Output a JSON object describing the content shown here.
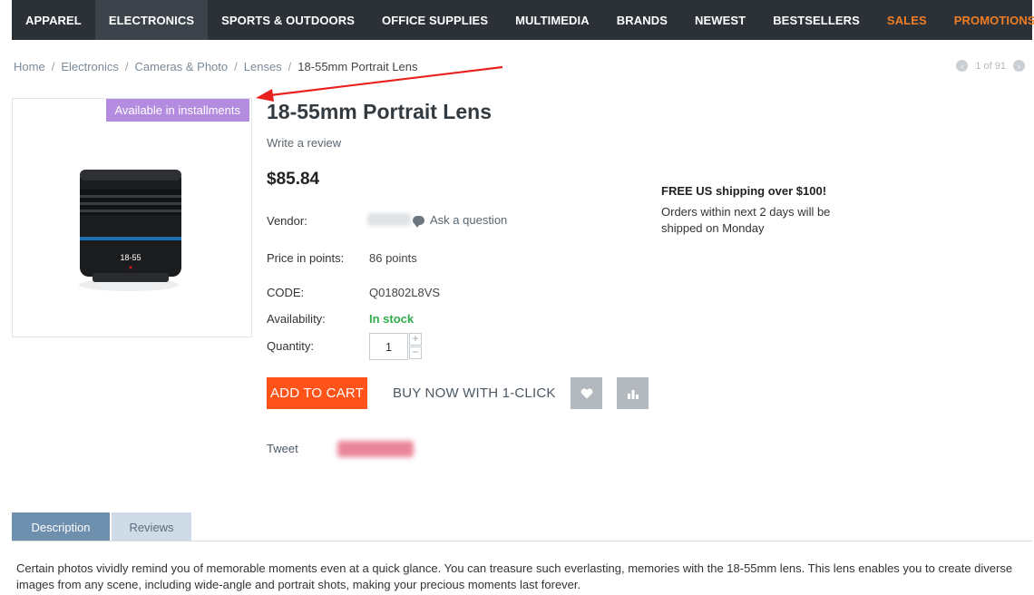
{
  "nav": {
    "items": [
      {
        "label": "APPAREL"
      },
      {
        "label": "ELECTRONICS"
      },
      {
        "label": "SPORTS & OUTDOORS"
      },
      {
        "label": "OFFICE SUPPLIES"
      },
      {
        "label": "MULTIMEDIA"
      },
      {
        "label": "BRANDS"
      },
      {
        "label": "NEWEST"
      },
      {
        "label": "BESTSELLERS"
      },
      {
        "label": "SALES"
      },
      {
        "label": "PROMOTIONS"
      }
    ],
    "active_label": "ELECTRONICS",
    "accent_color": "#f07d24",
    "background_color": "#2b3137"
  },
  "breadcrumb": {
    "items": [
      "Home",
      "Electronics",
      "Cameras & Photo",
      "Lenses",
      "18-55mm Portrait Lens"
    ],
    "separator": "/"
  },
  "pager": {
    "text": "1 of 91",
    "prev_icon": "chevron-left-icon",
    "next_icon": "chevron-right-icon"
  },
  "product": {
    "badge": "Available in installments",
    "badge_color": "#b38ce0",
    "title": "18-55mm Portrait Lens",
    "write_review": "Write a review",
    "price": "$85.84",
    "vendor_label": "Vendor:",
    "ask_question": "Ask a question",
    "points_label": "Price in points:",
    "points_value": "86 points",
    "code_label": "CODE:",
    "code_value": "Q01802L8VS",
    "availability_label": "Availability:",
    "availability_value": "In stock",
    "availability_color": "#2eae4b",
    "quantity_label": "Quantity:",
    "quantity_value": "1",
    "lens_marking": "18-55"
  },
  "actions": {
    "add_to_cart": "ADD TO CART",
    "add_to_cart_color": "#ff5319",
    "buy_now": "BUY NOW WITH 1-CLICK",
    "wishlist_icon": "heart-icon",
    "compare_icon": "compare-icon"
  },
  "social": {
    "tweet": "Tweet"
  },
  "shipping": {
    "title": "FREE US shipping over $100!",
    "text": "Orders within next 2 days will be shipped on Monday"
  },
  "tabs": [
    {
      "label": "Description"
    },
    {
      "label": "Reviews"
    }
  ],
  "description": "Certain photos vividly remind you of memorable moments even at a quick glance. You can treasure such everlasting, memories with the 18-55mm lens. This lens enables you to create diverse images from any scene, including wide-angle and portrait shots, making your precious moments last forever."
}
